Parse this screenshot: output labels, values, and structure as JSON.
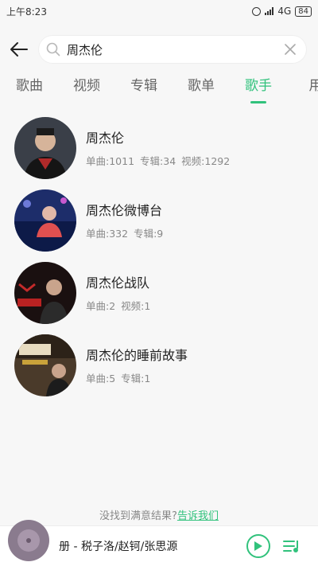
{
  "status_bar": {
    "time": "上午8:23",
    "network": "4G",
    "battery": "84"
  },
  "search": {
    "query": "周杰伦"
  },
  "tabs": [
    {
      "label": "歌曲",
      "active": false
    },
    {
      "label": "视频",
      "active": false
    },
    {
      "label": "专辑",
      "active": false
    },
    {
      "label": "歌单",
      "active": false
    },
    {
      "label": "歌手",
      "active": true
    },
    {
      "label": "用",
      "active": false
    }
  ],
  "results": [
    {
      "name": "周杰伦",
      "meta": [
        "单曲:1011",
        "专辑:34",
        "视频:1292"
      ]
    },
    {
      "name": "周杰伦微博台",
      "meta": [
        "单曲:332",
        "专辑:9"
      ]
    },
    {
      "name": "周杰伦战队",
      "meta": [
        "单曲:2",
        "视频:1"
      ]
    },
    {
      "name": "周杰伦的睡前故事",
      "meta": [
        "单曲:5",
        "专辑:1"
      ]
    }
  ],
  "footer": {
    "hint": "没找到满意结果?",
    "link": "告诉我们"
  },
  "player": {
    "song": "册 - 税子洛/赵钶/张思源"
  },
  "colors": {
    "accent": "#31c27c",
    "background": "#f7f7f7"
  }
}
